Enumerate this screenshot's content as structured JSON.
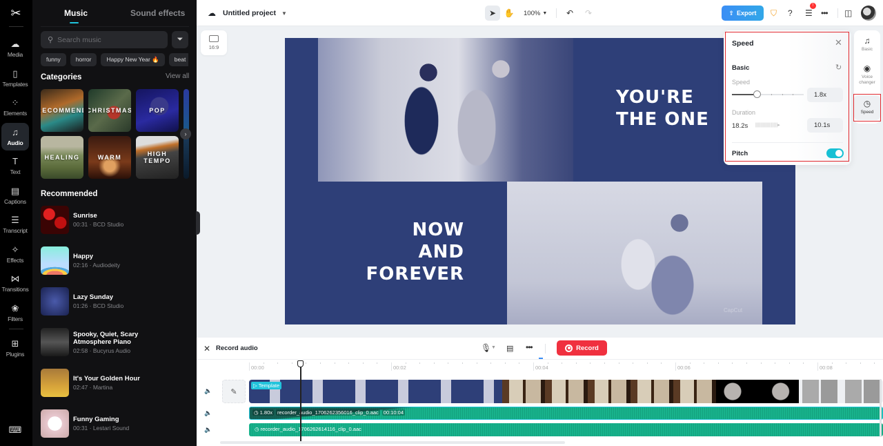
{
  "app": {
    "logo": "CapCut"
  },
  "rail": {
    "items": [
      {
        "label": "Media",
        "icon": "cloud-upload-icon",
        "glyph": "☁"
      },
      {
        "label": "Templates",
        "icon": "templates-icon",
        "glyph": "▯"
      },
      {
        "label": "Elements",
        "icon": "elements-icon",
        "glyph": "⁘"
      },
      {
        "label": "Audio",
        "icon": "music-note-icon",
        "glyph": "♫",
        "active": true
      },
      {
        "label": "Text",
        "icon": "text-icon",
        "glyph": "T"
      },
      {
        "label": "Captions",
        "icon": "captions-icon",
        "glyph": "▤"
      },
      {
        "label": "Transcript",
        "icon": "transcript-icon",
        "glyph": "☰"
      },
      {
        "label": "Effects",
        "icon": "effects-icon",
        "glyph": "✧"
      },
      {
        "label": "Transitions",
        "icon": "transitions-icon",
        "glyph": "⋈"
      },
      {
        "label": "Filters",
        "icon": "filters-icon",
        "glyph": "❀"
      },
      {
        "label": "Plugins",
        "icon": "plugins-icon",
        "glyph": "⊞"
      }
    ],
    "keyboard_glyph": "⌨"
  },
  "panel": {
    "tabs": [
      "Music",
      "Sound effects"
    ],
    "search_placeholder": "Search music",
    "chips": [
      "funny",
      "horror",
      "Happy New Year",
      "beat"
    ],
    "chip_fire": "🔥",
    "categories_title": "Categories",
    "view_all": "View all",
    "categories": [
      "RECOMMEND",
      "CHRISTMAS",
      "POP",
      "HEALING",
      "WARM",
      "HIGH TEMPO"
    ],
    "recommended_title": "Recommended",
    "songs": [
      {
        "title": "Sunrise",
        "meta": "00:31 · BCD Studio"
      },
      {
        "title": "Happy",
        "meta": "02:16 · Audiodeity"
      },
      {
        "title": "Lazy Sunday",
        "meta": "01:26 · BCD Studio"
      },
      {
        "title": "Spooky, Quiet, Scary Atmosphere Piano",
        "meta": "02:58 · Bucyrus Audio"
      },
      {
        "title": "It's Your Golden Hour",
        "meta": "02:47 · Martina"
      },
      {
        "title": "Funny Gaming",
        "meta": "00:31 · Lestari Sound"
      }
    ]
  },
  "topbar": {
    "project_name": "Untitled project",
    "zoom": "100%",
    "export_label": "Export",
    "notification_count": "!"
  },
  "canvas": {
    "aspect_ratio": "16:9",
    "text_top": "YOU'RE\nTHE ONE",
    "text_bottom": "NOW\nAND\nFOREVER",
    "watermark": "CapCut"
  },
  "speed_panel": {
    "title": "Speed",
    "section": "Basic",
    "speed_label": "Speed",
    "speed_value": "1.8x",
    "speed_slider_fraction": 0.35,
    "duration_label": "Duration",
    "duration_from": "18.2s",
    "duration_to": "10.1s",
    "pitch_label": "Pitch",
    "pitch_enabled": true
  },
  "right_tabs": [
    {
      "label": "Basic",
      "icon": "music-notes-icon",
      "glyph": "♫"
    },
    {
      "label": "Voice changer",
      "icon": "voice-changer-icon",
      "glyph": "◉"
    },
    {
      "label": "Speed",
      "icon": "speedometer-icon",
      "glyph": "◷",
      "active": true
    }
  ],
  "timeline": {
    "title": "Record audio",
    "record_label": "Record",
    "ruler": [
      "00:00",
      "00:02",
      "00:04",
      "00:06",
      "00:08"
    ],
    "template_badge": "Template",
    "audio1": {
      "speed": "1.80x",
      "name": "recorder_audio_1706262356016_clip_0.aac",
      "duration": "00:10:04"
    },
    "audio2": {
      "name": "recorder_audio_1706262614116_clip_0.aac"
    }
  }
}
